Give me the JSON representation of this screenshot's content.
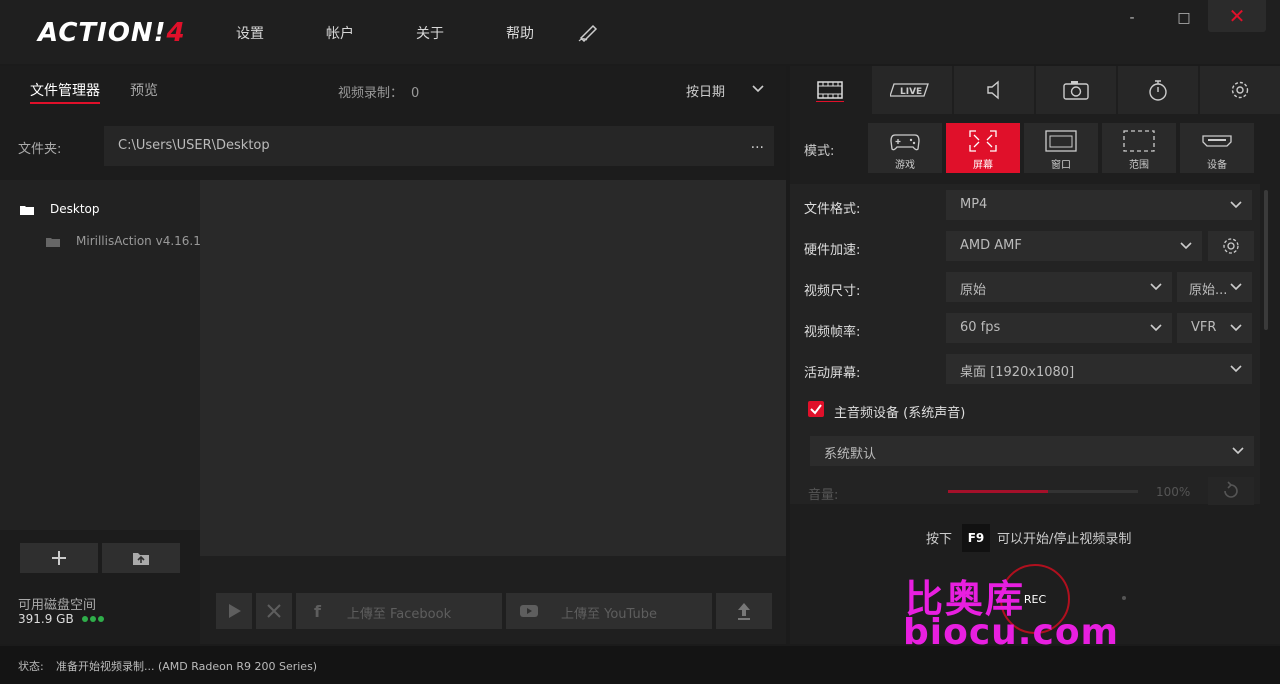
{
  "app": {
    "logo_text": "ACTION!",
    "logo_version": "4",
    "menu": [
      "设置",
      "帐户",
      "关于",
      "帮助"
    ],
    "window": {
      "minimize": "-",
      "maximize": "□",
      "close": "✕"
    }
  },
  "left": {
    "tabs": {
      "files": "文件管理器",
      "preview": "预览"
    },
    "rec_count_label": "视频录制：",
    "rec_count": "0",
    "sort_label": "按日期",
    "folder_label": "文件夹:",
    "folder_path": "C:\\Users\\USER\\Desktop",
    "folder_more": "...",
    "tree": [
      {
        "label": "Desktop"
      },
      {
        "label": "MirillisAction v4.16.1..."
      }
    ],
    "disk": {
      "label": "可用磁盘空间",
      "value": "391.9 GB"
    },
    "actions": {
      "facebook": "上傳至 Facebook",
      "youtube": "上傳至 YouTube"
    }
  },
  "right": {
    "mode_label": "模式:",
    "modes": [
      {
        "label": "游戏"
      },
      {
        "label": "屏幕"
      },
      {
        "label": "窗口"
      },
      {
        "label": "范围"
      },
      {
        "label": "设备"
      }
    ],
    "settings": {
      "format_label": "文件格式:",
      "format_value": "MP4",
      "hw_label": "硬件加速:",
      "hw_value": "AMD AMF",
      "size_label": "视频尺寸:",
      "size_value": "原始",
      "size_value2": "原始...",
      "fps_label": "视频帧率:",
      "fps_value": "60 fps",
      "fps_mode": "VFR",
      "screen_label": "活动屏幕:",
      "screen_value": "桌面 [1920x1080]",
      "audio_label": "主音频设备 (系统声音)",
      "audio_value": "系统默认",
      "volume_label": "音量:",
      "volume_pct": "100%"
    },
    "hint_pre": "按下",
    "hint_key": "F9",
    "hint_post": "可以开始/停止视频录制",
    "rec_label": "REC"
  },
  "watermark": {
    "line1": "比奥库",
    "line2": "biocu.com"
  },
  "status": {
    "label": "状态:",
    "text": "准备开始视频录制... (AMD Radeon R9 200 Series)"
  },
  "colors": {
    "accent": "#e0102a",
    "ok": "#2fae4a",
    "watermark": "#e81fe0"
  }
}
